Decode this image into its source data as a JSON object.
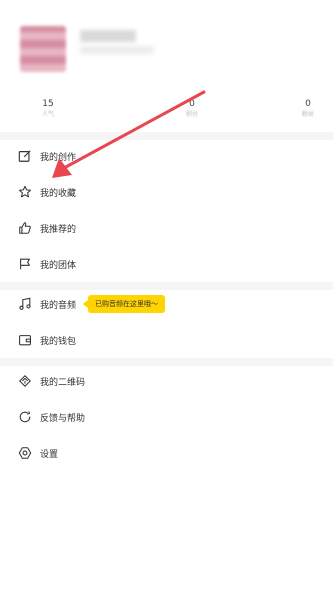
{
  "profile": {
    "stats": [
      {
        "value": "15",
        "label": "人气"
      },
      {
        "value": "0",
        "label": "积分"
      },
      {
        "value": "0",
        "label": "粉丝"
      }
    ]
  },
  "menu": {
    "creation": {
      "label": "我的创作",
      "icon": "edit-icon"
    },
    "favorites": {
      "label": "我的收藏",
      "icon": "star-icon"
    },
    "recommended": {
      "label": "我推荐的",
      "icon": "thumbs-up-icon"
    },
    "group": {
      "label": "我的团体",
      "icon": "flag-icon"
    },
    "audio": {
      "label": "我的音频",
      "icon": "music-note-icon",
      "tooltip": "已购音频在这里哦～"
    },
    "wallet": {
      "label": "我的钱包",
      "icon": "wallet-icon"
    },
    "qrcode": {
      "label": "我的二维码",
      "icon": "qrcode-icon"
    },
    "feedback": {
      "label": "反馈与帮助",
      "icon": "feedback-icon"
    },
    "settings": {
      "label": "设置",
      "icon": "settings-icon"
    }
  },
  "colors": {
    "tooltip": "#ffd400",
    "annotation_arrow": "#e8474f",
    "divider": "#f5f5f5"
  }
}
